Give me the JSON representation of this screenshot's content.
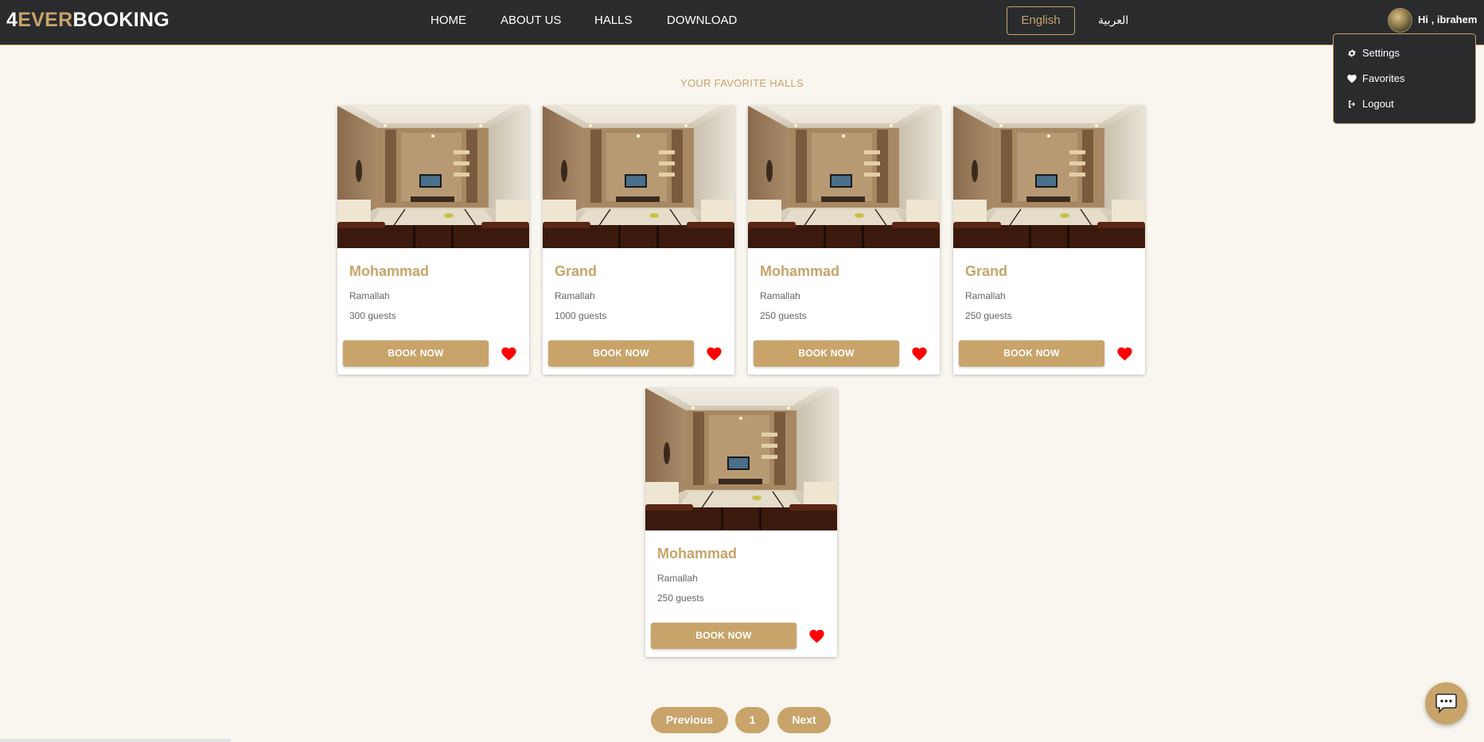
{
  "brand": {
    "part1": "4",
    "part2": "EVER",
    "part3": "BOOKING"
  },
  "nav": {
    "links": [
      "HOME",
      "ABOUT US",
      "HALLS",
      "DOWNLOAD"
    ],
    "language_active": "English",
    "language_alt": "العربية",
    "greeting": "Hi , ibrahem"
  },
  "dropdown": {
    "items": [
      {
        "label": "Settings",
        "icon": "gear-icon"
      },
      {
        "label": "Favorites",
        "icon": "heart-icon"
      },
      {
        "label": "Logout",
        "icon": "logout-icon"
      }
    ]
  },
  "page": {
    "heading": "YOUR FAVORITE HALLS"
  },
  "halls": [
    {
      "name": "Mohammad",
      "city": "Ramallah",
      "guests": "300 guests",
      "button": "BOOK NOW",
      "favorite": true
    },
    {
      "name": "Grand",
      "city": "Ramallah",
      "guests": "1000 guests",
      "button": "BOOK NOW",
      "favorite": true
    },
    {
      "name": "Mohammad",
      "city": "Ramallah",
      "guests": "250 guests",
      "button": "BOOK NOW",
      "favorite": true
    },
    {
      "name": "Grand",
      "city": "Ramallah",
      "guests": "250 guests",
      "button": "BOOK NOW",
      "favorite": true
    },
    {
      "name": "Mohammad",
      "city": "Ramallah",
      "guests": "250 guests",
      "button": "BOOK NOW",
      "favorite": true
    }
  ],
  "pagination": {
    "previous": "Previous",
    "current": "1",
    "next": "Next"
  },
  "colors": {
    "accent": "#c8a46a",
    "navbar": "#2a2b2d",
    "background": "#f9f6ef",
    "heart": "#ff0000"
  }
}
